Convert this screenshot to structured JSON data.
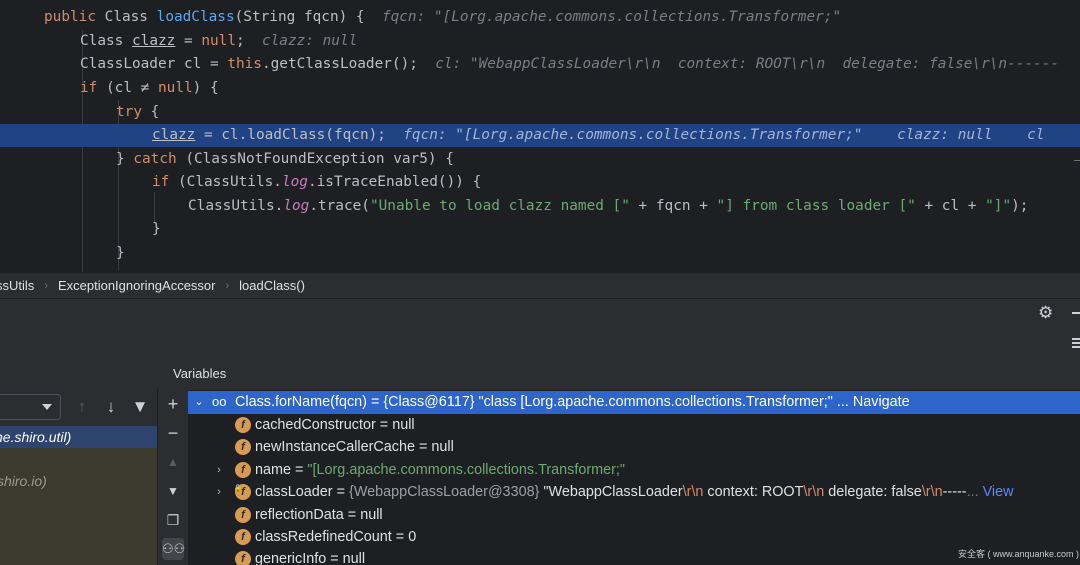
{
  "code": {
    "line1": {
      "kw": "public",
      "type": "Class",
      "method": "loadClass",
      "params": "(String fqcn) {",
      "hint": "fqcn: \"[Lorg.apache.commons.collections.Transformer;\""
    },
    "line2": {
      "type": "Class",
      "var": "clazz",
      "eq": " = ",
      "kw": "null",
      "semi": ";",
      "hint": "clazz: null"
    },
    "line3": {
      "type": "ClassLoader",
      "var": "cl",
      "eq": " = ",
      "kw": "this",
      "call": ".getClassLoader();",
      "hint": "cl: \"WebappClassLoader\\r\\n  context: ROOT\\r\\n  delegate: false\\r\\n------"
    },
    "line4": {
      "kw": "if",
      "cond1": " (cl ",
      "ne": "≠",
      "kw2": "null",
      "cond2": ") {"
    },
    "line5": {
      "kw": "try",
      "rest": " {"
    },
    "line6": {
      "var": "clazz",
      "call": " = cl.loadClass(fqcn);",
      "hint1": "fqcn: \"[Lorg.apache.commons.collections.Transformer;\"",
      "hint2": "clazz: null",
      "hint3": "cl"
    },
    "line7": {
      "brace": "} ",
      "kw": "catch",
      "rest": " (ClassNotFoundException var5) {"
    },
    "line8": {
      "kw": "if",
      "pre": " (ClassUtils.",
      "field": "log",
      "post": ".isTraceEnabled()) {"
    },
    "line9": {
      "pre": "ClassUtils.",
      "field": "log",
      "call": ".trace(",
      "s1": "\"Unable to load clazz named [\"",
      "mid1": " + fqcn + ",
      "s2": "\"] from class loader [\"",
      "mid2": " + cl + ",
      "s3": "\"]\"",
      "end": ");"
    },
    "line10": {
      "text": "}"
    },
    "line11": {
      "text": "}"
    }
  },
  "breadcrumb": {
    "items": [
      "ssUtils",
      "ExceptionIgnoringAccessor",
      "loadClass()"
    ]
  },
  "frames": {
    "selected": "he.shiro.util)",
    "second": "shiro.io)"
  },
  "variables": {
    "title": "Variables",
    "root": {
      "expr": "Class.forName(fqcn)",
      "value": " = {Class@6117} \"class [Lorg.apache.commons.collections.Transformer;\" ... ",
      "nav": "Navigate"
    },
    "fields": [
      {
        "icon": "f",
        "name": "cachedConstructor",
        "eq": " = ",
        "value": "null",
        "kind": "plain"
      },
      {
        "icon": "f",
        "name": "newInstanceCallerCache",
        "eq": " = ",
        "value": "null",
        "kind": "plain"
      },
      {
        "icon": "f",
        "name": "name",
        "eq": " = ",
        "value": "\"[Lorg.apache.commons.collections.Transformer;\"",
        "kind": "string"
      },
      {
        "icon": "f",
        "name": "classLoader",
        "eq": " = ",
        "value": "{WebappClassLoader@3308}",
        "kind": "object"
      },
      {
        "icon": "f",
        "name": "reflectionData",
        "eq": " = ",
        "value": "null",
        "kind": "plain"
      },
      {
        "icon": "f",
        "name": "classRedefinedCount",
        "eq": " = ",
        "value": "0",
        "kind": "plain"
      },
      {
        "icon": "f",
        "name": "genericInfo",
        "eq": " = ",
        "value": "null",
        "kind": "plain"
      }
    ],
    "classloader_desc": {
      "a": " \"WebappClassLoader",
      "esc1": "\\r\\n",
      "b": "  context: ROOT",
      "esc2": "\\r\\n",
      "c": "  delegate: false",
      "esc3": "\\r\\n",
      "d": "-----",
      "ellipsis": "... ",
      "link": "View"
    }
  },
  "watermark": "安全客 ( www.anquanke.com )",
  "colors": {
    "selection": "#2e65ca",
    "debug_line": "#214283",
    "field_icon": "#d79c52"
  },
  "icons": [
    "gear-icon",
    "add-icon",
    "remove-icon",
    "up-arrow-icon",
    "down-arrow-icon",
    "filter-icon",
    "copy-icon",
    "glasses-icon",
    "chevron-down-icon",
    "chevron-right-icon"
  ]
}
